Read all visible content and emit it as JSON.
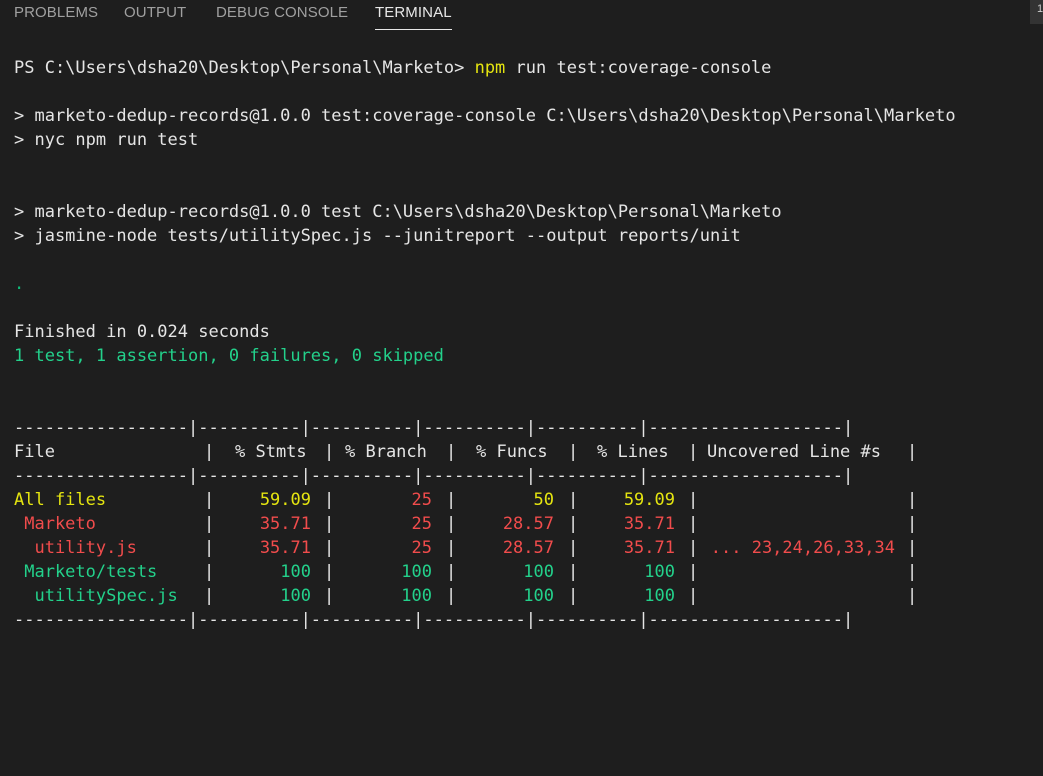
{
  "tabs": [
    {
      "label": "PROBLEMS",
      "active": false
    },
    {
      "label": "OUTPUT",
      "active": false
    },
    {
      "label": "DEBUG CONSOLE",
      "active": false
    },
    {
      "label": "TERMINAL",
      "active": true
    }
  ],
  "corner_label": "1",
  "lines": {
    "prompt": "PS C:\\Users\\dsha20\\Desktop\\Personal\\Marketo> ",
    "prompt_cmd": "npm",
    "prompt_args": " run test:coverage-console",
    "script1_a": "> marketo-dedup-records@1.0.0 test:coverage-console C:\\Users\\dsha20\\Desktop\\Personal\\Marketo",
    "script1_b": "> nyc npm run test",
    "script2_a": "> marketo-dedup-records@1.0.0 test C:\\Users\\dsha20\\Desktop\\Personal\\Marketo",
    "script2_b": "> jasmine-node tests/utilitySpec.js --junitreport --output reports/unit",
    "progress_dot": ".",
    "finished": "Finished in 0.024 seconds",
    "summary": "1 test, 1 assertion, 0 failures, 0 skipped"
  },
  "coverage": {
    "separator": "-----------------|----------|----------|----------|----------|-------------------|",
    "headers": [
      "File",
      "% Stmts",
      "% Branch",
      "% Funcs",
      "% Lines",
      "Uncovered Line #s"
    ],
    "rows": [
      {
        "file": "All files",
        "stmts": "59.09",
        "branch": "25",
        "funcs": "50",
        "lines": "59.09",
        "uncovered": "",
        "colors": [
          "y",
          "y",
          "r",
          "y",
          "y",
          ""
        ]
      },
      {
        "file": " Marketo",
        "stmts": "35.71",
        "branch": "25",
        "funcs": "28.57",
        "lines": "35.71",
        "uncovered": "",
        "colors": [
          "r",
          "r",
          "r",
          "r",
          "r",
          ""
        ]
      },
      {
        "file": "  utility.js",
        "stmts": "35.71",
        "branch": "25",
        "funcs": "28.57",
        "lines": "35.71",
        "uncovered": "... 23,24,26,33,34",
        "colors": [
          "r",
          "r",
          "r",
          "r",
          "r",
          "r"
        ]
      },
      {
        "file": " Marketo/tests",
        "stmts": "100",
        "branch": "100",
        "funcs": "100",
        "lines": "100",
        "uncovered": "",
        "colors": [
          "g",
          "g",
          "g",
          "g",
          "g",
          ""
        ]
      },
      {
        "file": "  utilitySpec.js",
        "stmts": "100",
        "branch": "100",
        "funcs": "100",
        "lines": "100",
        "uncovered": "",
        "colors": [
          "g",
          "g",
          "g",
          "g",
          "g",
          ""
        ]
      }
    ]
  }
}
